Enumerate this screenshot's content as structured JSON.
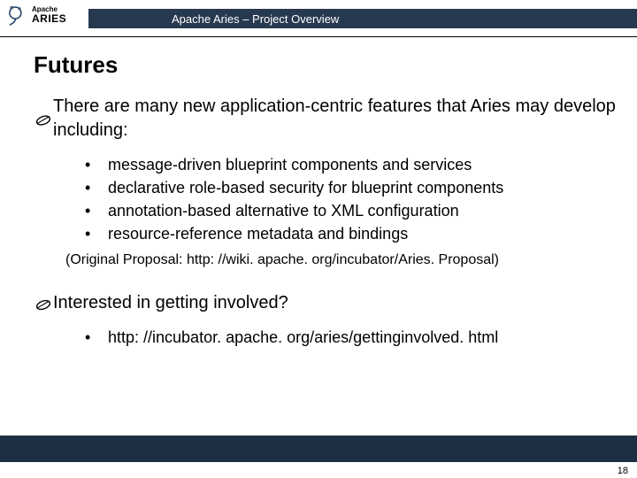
{
  "header": {
    "logo_small": "Apache",
    "logo_large": "ARIES",
    "title": "Apache Aries – Project Overview"
  },
  "slide": {
    "title": "Futures",
    "intro": "There are many new application-centric features that Aries may develop including:",
    "features": [
      "message-driven blueprint components and services",
      "declarative role-based security for blueprint components",
      "annotation-based alternative to XML configuration",
      "resource-reference metadata and bindings"
    ],
    "proposal": "(Original Proposal: http: //wiki. apache. org/incubator/Aries. Proposal)",
    "involved": "Interested in getting involved?",
    "involved_link": "http: //incubator. apache. org/aries/gettinginvolved. html"
  },
  "page_number": "18"
}
